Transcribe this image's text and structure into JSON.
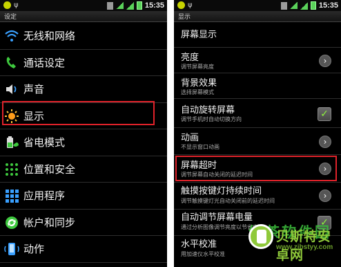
{
  "left_screen": {
    "status_time": "15:35",
    "title": "设定",
    "items": [
      {
        "label": "无线和网络",
        "icon": "wifi-icon"
      },
      {
        "label": "通话设定",
        "icon": "phone-icon"
      },
      {
        "label": "声音",
        "icon": "speaker-icon"
      },
      {
        "label": "显示",
        "icon": "brightness-icon"
      },
      {
        "label": "省电模式",
        "icon": "battery-leaf-icon"
      },
      {
        "label": "位置和安全",
        "icon": "grid-lock-icon"
      },
      {
        "label": "应用程序",
        "icon": "apps-icon"
      },
      {
        "label": "帐户和同步",
        "icon": "sync-icon"
      },
      {
        "label": "动作",
        "icon": "motion-phone-icon"
      }
    ],
    "highlighted_item": "显示"
  },
  "right_screen": {
    "status_time": "15:35",
    "title": "显示",
    "section_header": "屏幕显示",
    "items": [
      {
        "title": "亮度",
        "subtitle": "调节屏幕亮度",
        "control": "arrow"
      },
      {
        "title": "背景效果",
        "subtitle": "选择屏幕模式",
        "control": "none"
      },
      {
        "title": "自动旋转屏幕",
        "subtitle": "调节手机时自动切换方向",
        "control": "checkbox",
        "checked": true
      },
      {
        "title": "动画",
        "subtitle": "不显示窗口动画",
        "control": "arrow"
      },
      {
        "title": "屏幕超时",
        "subtitle": "调节屏幕自动关闭的延迟时间",
        "control": "arrow"
      },
      {
        "title": "触摸按键灯持续时间",
        "subtitle": "调节触摸键灯光自动关闭前的延迟时间",
        "control": "arrow"
      },
      {
        "title": "自动调节屏幕电量",
        "subtitle": "通过分析图像调节亮度以节省电量",
        "control": "checkbox",
        "checked": true
      },
      {
        "title": "水平校准",
        "subtitle": "用加速仪水平校准",
        "control": "none"
      }
    ],
    "highlighted_item": "屏幕超时"
  },
  "watermark": {
    "name": "贝斯特安卓网",
    "url": "www.zjbstyy.com",
    "ghost_text": "绿茶软件园"
  },
  "colors": {
    "highlight": "#e0222a",
    "check": "#8ef53e",
    "brand_green": "#8fc93a"
  }
}
